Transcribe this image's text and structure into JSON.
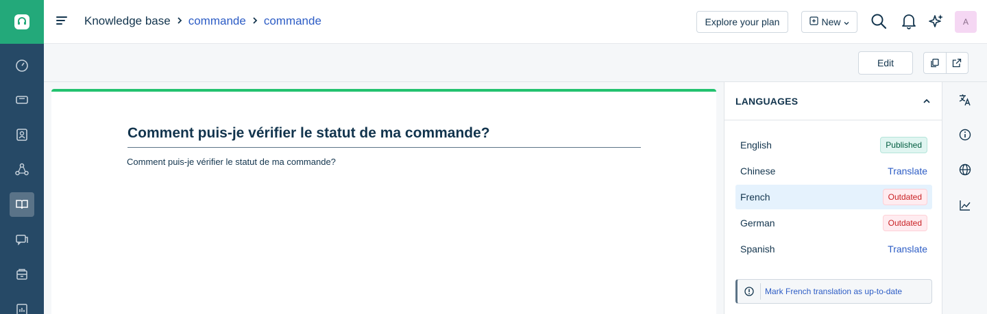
{
  "header": {
    "breadcrumb": {
      "root": "Knowledge base",
      "level1": "commande",
      "level2": "commande"
    },
    "explore_button": "Explore your plan",
    "new_button": "New",
    "avatar_initial": "A"
  },
  "toolbar": {
    "edit_label": "Edit"
  },
  "article": {
    "title": "Comment puis-je vérifier le statut de ma commande?",
    "body": "Comment puis-je vérifier le statut de ma commande?"
  },
  "languages": {
    "title": "LANGUAGES",
    "items": [
      {
        "name": "English",
        "status": "Published",
        "kind": "published"
      },
      {
        "name": "Chinese",
        "status": "Translate",
        "kind": "link"
      },
      {
        "name": "French",
        "status": "Outdated",
        "kind": "outdated",
        "selected": true
      },
      {
        "name": "German",
        "status": "Outdated",
        "kind": "outdated"
      },
      {
        "name": "Spanish",
        "status": "Translate",
        "kind": "link"
      }
    ],
    "mark_action": "Mark French translation as up-to-date"
  },
  "colors": {
    "rail": "#264966",
    "brand": "#23a97a",
    "accent": "#2c5cc5",
    "article_border": "#23c26f"
  },
  "icons": {
    "rail": [
      "dashboard-icon",
      "tickets-icon",
      "contacts-icon",
      "groups-icon",
      "knowledge-base-icon",
      "conversations-icon",
      "marketplace-icon",
      "reports-icon"
    ],
    "right_rail": [
      "translate-icon",
      "info-icon",
      "globe-icon",
      "analytics-icon"
    ]
  }
}
